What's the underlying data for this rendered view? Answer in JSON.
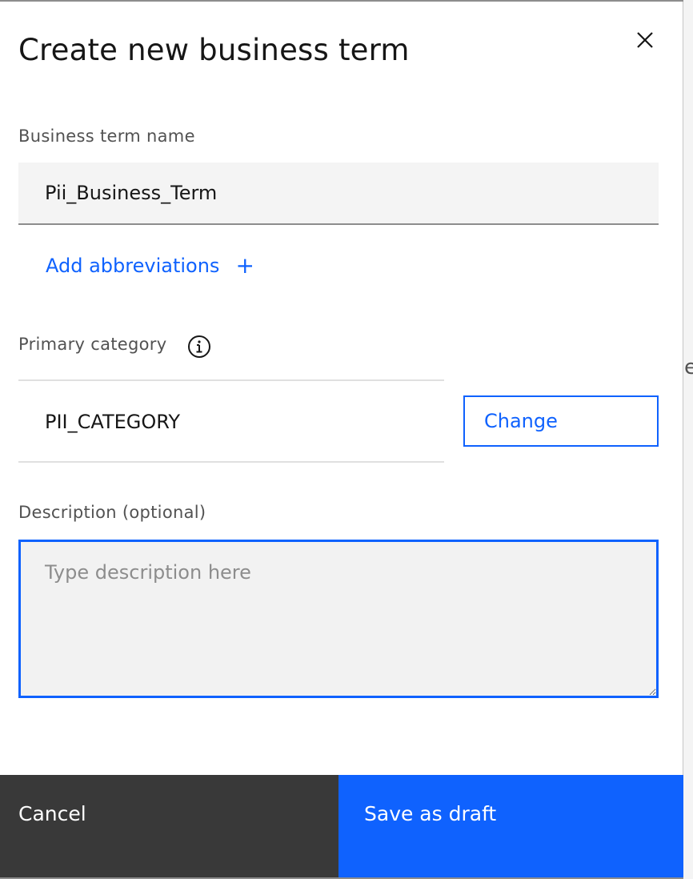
{
  "modal": {
    "title": "Create new business term",
    "close_icon": "close-icon"
  },
  "name_field": {
    "label": "Business term name",
    "value": "Pii_Business_Term"
  },
  "abbreviations": {
    "label": "Add abbreviations",
    "icon": "plus-icon",
    "icon_glyph": "+"
  },
  "category": {
    "label": "Primary category",
    "info_icon": "info-icon",
    "value": "PII_CATEGORY",
    "change_label": "Change"
  },
  "description": {
    "label": "Description (optional)",
    "placeholder": "Type description here",
    "value": ""
  },
  "footer": {
    "cancel_label": "Cancel",
    "save_label": "Save as draft"
  },
  "backdrop": {
    "peek_glyph": "e"
  },
  "colors": {
    "accent": "#0f62fe",
    "cancel_bg": "#393939",
    "field_bg": "#f4f4f4",
    "text_primary": "#161616",
    "text_secondary": "#525252"
  }
}
